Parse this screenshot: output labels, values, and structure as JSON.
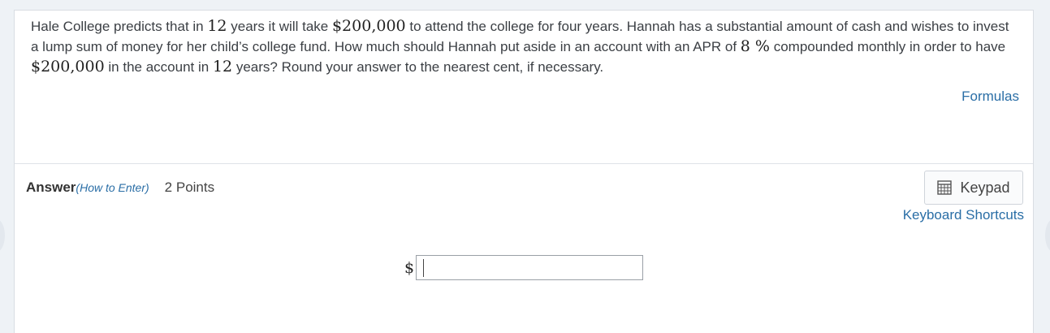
{
  "question": {
    "seg1": "Hale College predicts that in ",
    "m1": "12",
    "seg2": " years it will take ",
    "m2": "$200,000",
    "seg3": " to attend the college for four years. Hannah has a substantial amount of cash and wishes to invest a lump sum of money for her child’s college fund. How much should Hannah put aside in an account with an APR of ",
    "m3": "8 %",
    "seg4": " compounded monthly in order to have ",
    "m4": "$200,000",
    "seg5": " in the account in ",
    "m5": "12",
    "seg6": " years? Round your answer to the nearest cent, if necessary."
  },
  "links": {
    "formulas": "Formulas",
    "keyboard_shortcuts": "Keyboard Shortcuts"
  },
  "answer": {
    "label": "Answer",
    "how_to_enter": "(How to Enter)",
    "points": "2 Points",
    "prefix": "$",
    "value": ""
  },
  "keypad": {
    "label": "Keypad",
    "icon": "calculator-icon"
  }
}
